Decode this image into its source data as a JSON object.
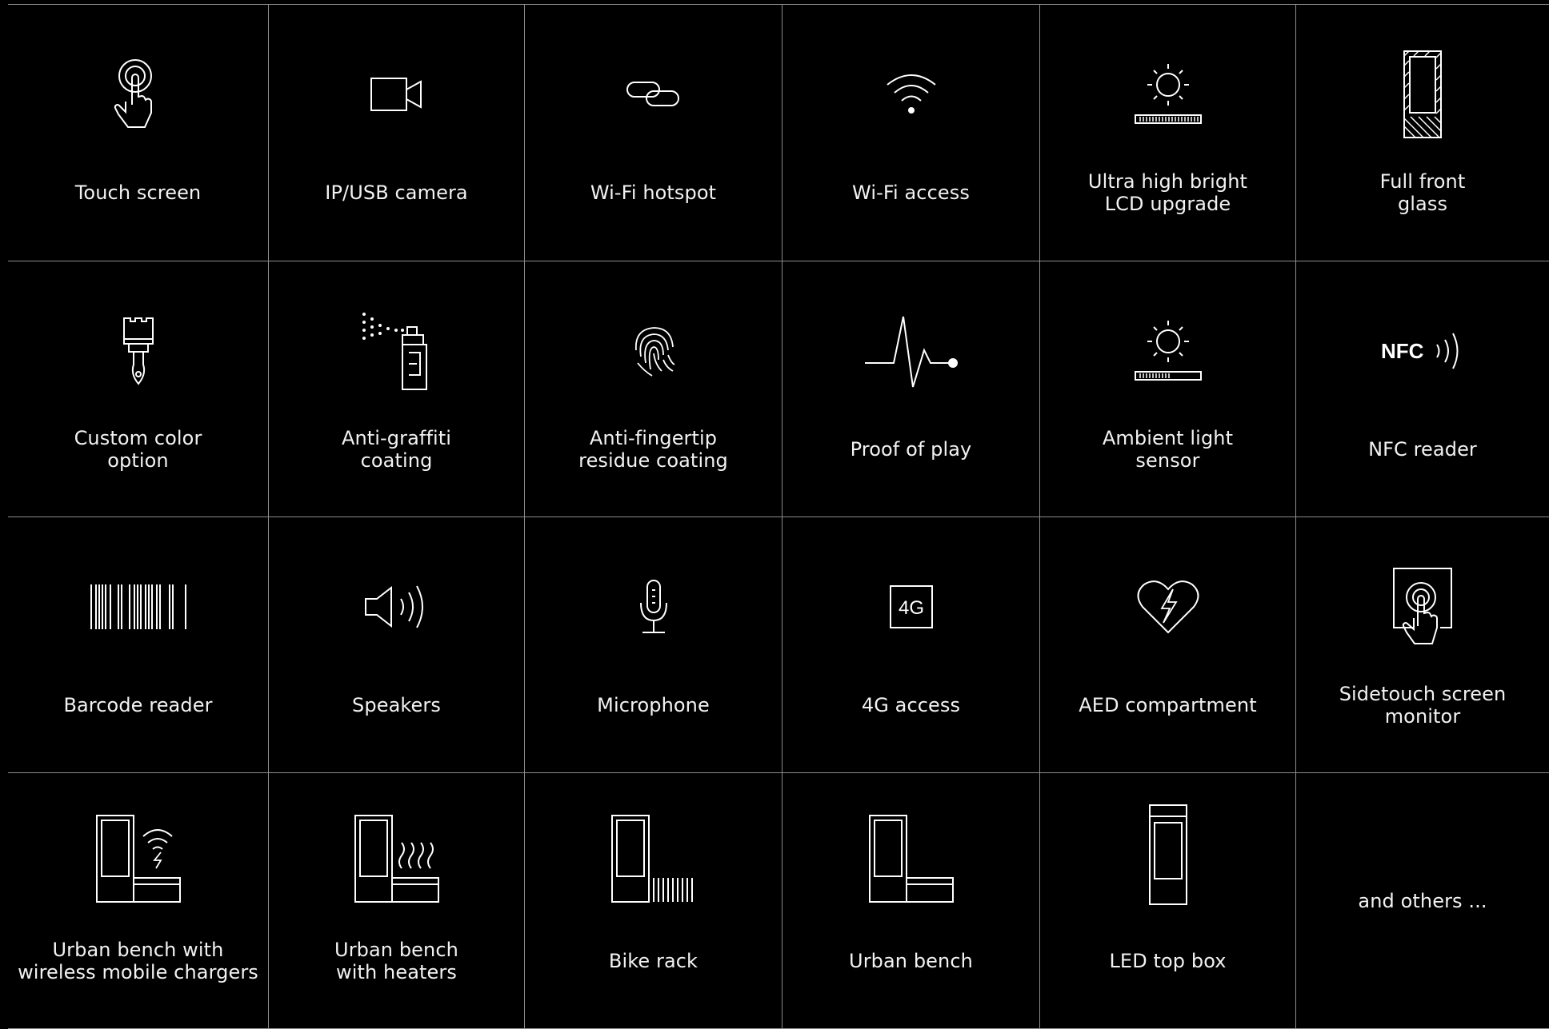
{
  "features": [
    {
      "icon": "touch-screen-icon",
      "label": "Touch screen"
    },
    {
      "icon": "camera-icon",
      "label": "IP/USB camera"
    },
    {
      "icon": "link-icon",
      "label": "Wi-Fi hotspot"
    },
    {
      "icon": "wifi-icon",
      "label": "Wi-Fi access"
    },
    {
      "icon": "sun-lcd-icon",
      "label": "Ultra high bright\nLCD upgrade"
    },
    {
      "icon": "front-glass-icon",
      "label": "Full front\nglass"
    },
    {
      "icon": "paint-brush-icon",
      "label": "Custom color\noption"
    },
    {
      "icon": "spray-can-icon",
      "label": "Anti-graffiti\ncoating"
    },
    {
      "icon": "fingerprint-icon",
      "label": "Anti-fingertip\nresidue coating"
    },
    {
      "icon": "pulse-icon",
      "label": "Proof of play"
    },
    {
      "icon": "ambient-sun-icon",
      "label": "Ambient light\nsensor"
    },
    {
      "icon": "nfc-icon",
      "label": "NFC reader",
      "icon_text": "NFC"
    },
    {
      "icon": "barcode-icon",
      "label": "Barcode reader"
    },
    {
      "icon": "speaker-icon",
      "label": "Speakers"
    },
    {
      "icon": "microphone-icon",
      "label": "Microphone"
    },
    {
      "icon": "4g-icon",
      "label": "4G access",
      "icon_text": "4G"
    },
    {
      "icon": "aed-heart-icon",
      "label": "AED compartment"
    },
    {
      "icon": "sidetouch-icon",
      "label": "Sidetouch screen\nmonitor"
    },
    {
      "icon": "bench-wireless-icon",
      "label": "Urban bench with\nwireless mobile chargers"
    },
    {
      "icon": "bench-heater-icon",
      "label": "Urban bench\nwith heaters"
    },
    {
      "icon": "bike-rack-icon",
      "label": "Bike rack"
    },
    {
      "icon": "urban-bench-icon",
      "label": "Urban bench"
    },
    {
      "icon": "led-top-box-icon",
      "label": "LED top box"
    },
    {
      "icon": "",
      "label": "and others ..."
    }
  ]
}
